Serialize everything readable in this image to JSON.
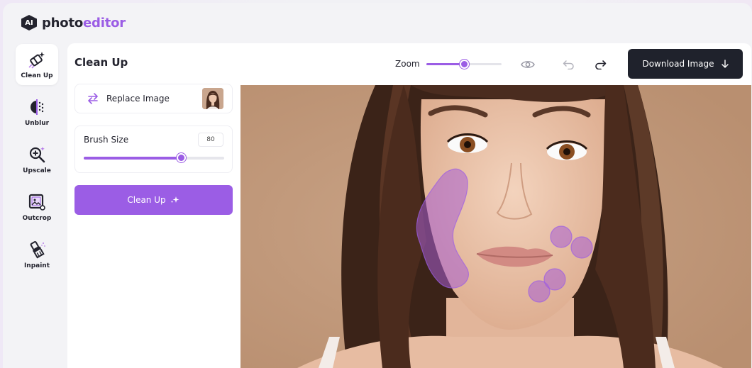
{
  "brand": {
    "badge": "AI",
    "name_part1": "photo",
    "name_part2": "editor"
  },
  "sidebar": {
    "items": [
      {
        "label": "Clean Up",
        "icon": "eraser-sparkle-icon",
        "active": true
      },
      {
        "label": "Unblur",
        "icon": "unblur-icon",
        "active": false
      },
      {
        "label": "Upscale",
        "icon": "magnify-plus-icon",
        "active": false
      },
      {
        "label": "Outcrop",
        "icon": "outcrop-image-icon",
        "active": false
      },
      {
        "label": "Inpaint",
        "icon": "paint-brush-icon",
        "active": false
      }
    ]
  },
  "header": {
    "title": "Clean Up",
    "zoom_label": "Zoom",
    "zoom_level_percent": 50,
    "download_label": "Download Image"
  },
  "panel": {
    "replace_label": "Replace Image",
    "brush_label": "Brush Size",
    "brush_value": "80",
    "brush_fill_percent": 69,
    "cleanup_label": "Clean Up"
  },
  "colors": {
    "accent": "#9b5de5",
    "dark_button": "#1f222c",
    "canvas_bg": "#c39c7e"
  }
}
